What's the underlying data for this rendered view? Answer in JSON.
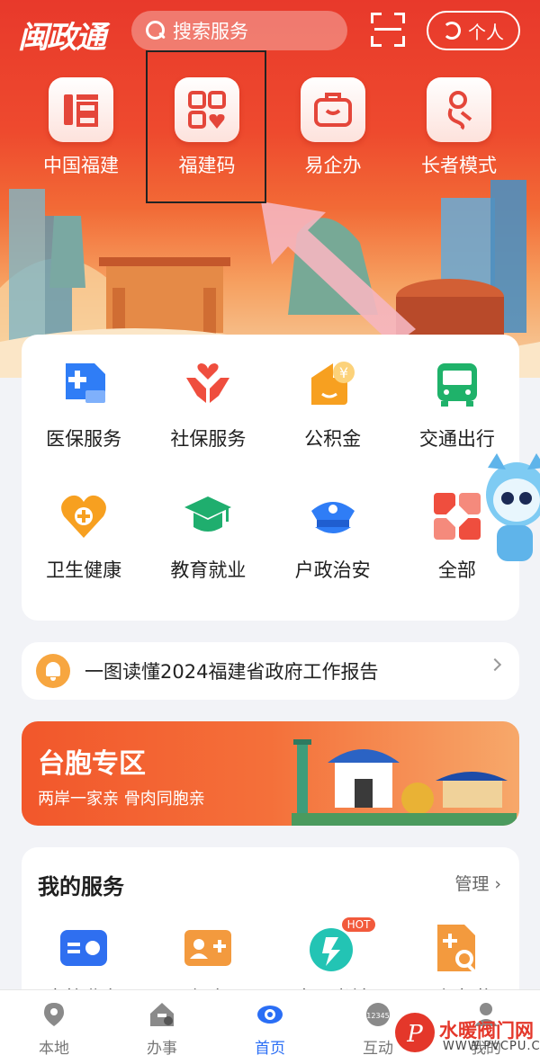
{
  "header": {
    "logo": "闽政通",
    "search_placeholder": "搜索服务",
    "personal_label": "个人"
  },
  "top_apps": [
    {
      "label": "中国福建",
      "icon": "fu-character-icon"
    },
    {
      "label": "福建码",
      "icon": "qr-code-heart-icon"
    },
    {
      "label": "易企办",
      "icon": "briefcase-icon"
    },
    {
      "label": "长者模式",
      "icon": "elder-mode-icon"
    }
  ],
  "services": [
    {
      "label": "医保服务",
      "icon": "medical-insurance-icon",
      "color": "#2f7df6"
    },
    {
      "label": "社保服务",
      "icon": "hands-heart-icon",
      "color": "#ef4e3e"
    },
    {
      "label": "公积金",
      "icon": "housing-fund-icon",
      "color": "#f7a020"
    },
    {
      "label": "交通出行",
      "icon": "bus-icon",
      "color": "#1fb26a"
    },
    {
      "label": "卫生健康",
      "icon": "health-heart-icon",
      "color": "#f7a020"
    },
    {
      "label": "教育就业",
      "icon": "graduation-cap-icon",
      "color": "#1fae6e"
    },
    {
      "label": "户政治安",
      "icon": "police-cap-icon",
      "color": "#2f7df6"
    },
    {
      "label": "全部",
      "icon": "all-apps-icon",
      "color": "#ef4e3e"
    }
  ],
  "notice": {
    "text": "一图读懂2024福建省政府工作报告"
  },
  "banner": {
    "title": "台胞专区",
    "subtitle": "两岸一家亲 骨肉同胞亲"
  },
  "my_services": {
    "title": "我的服务",
    "manage": "管理 ›",
    "items": [
      {
        "label": "户籍业务",
        "icon": "id-card-icon",
        "color": "#2f6ff0"
      },
      {
        "label": "医保电子",
        "icon": "medical-card-icon",
        "color": "#f39a3e"
      },
      {
        "label": "省图书馆",
        "icon": "library-icon",
        "color": "#23c4b4",
        "badge": "HOT"
      },
      {
        "label": "医保机构",
        "icon": "medical-search-icon",
        "color": "#f39a3e"
      }
    ]
  },
  "bottom_nav": [
    {
      "label": "本地",
      "icon": "location-pin-icon"
    },
    {
      "label": "办事",
      "icon": "house-service-icon"
    },
    {
      "label": "首页",
      "icon": "home-logo-icon",
      "active": true
    },
    {
      "label": "互动",
      "icon": "phone-12345-icon"
    },
    {
      "label": "我的",
      "icon": "person-icon"
    }
  ],
  "watermark": {
    "text": "水暖阀门网",
    "sub": "WWW.PVCPU.COM"
  }
}
